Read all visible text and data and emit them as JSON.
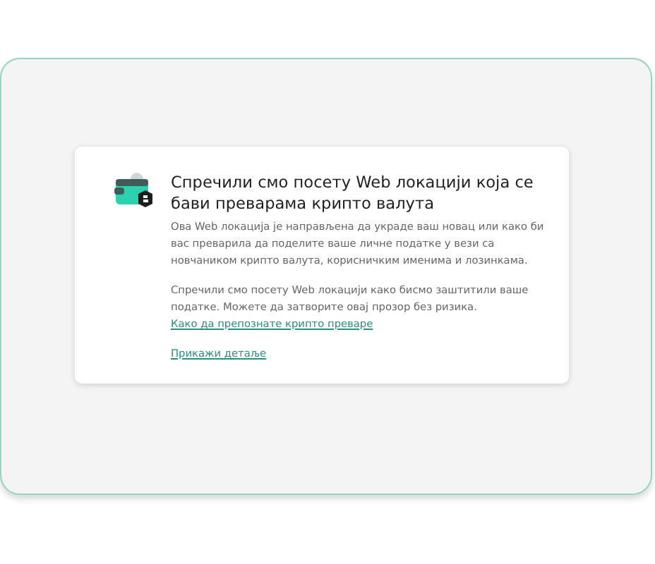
{
  "dialog": {
    "title": "Спречили смо посету Web локацији која се бави преварама крипто валута",
    "description": "Ова Web локација је направљена да украде ваш новац или како би вас преварила да поделите ваше личне податке у вези са новчаником крипто валута, корисничким именима и лозинкама.",
    "note": "Спречили смо посету Web локацији како бисмо заштитили ваше податке. Можете да затворите овај прозор без ризика.",
    "links": [
      "Како да препознате крипто преваре",
      "Прикажи детаље"
    ]
  }
}
